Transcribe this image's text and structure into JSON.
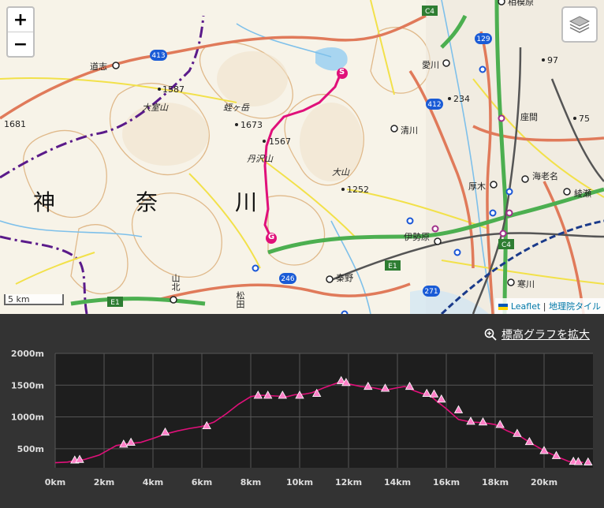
{
  "map": {
    "zoom_in": "+",
    "zoom_out": "−",
    "scale_label": "5 km",
    "attribution_leaflet": "Leaflet",
    "attribution_separator": " | ",
    "attribution_tiles": "地理院タイル",
    "region_chars": [
      "神",
      "奈",
      "川"
    ],
    "place_labels": [
      "道志",
      "大室山",
      "蛭ヶ岳",
      "丹沢山",
      "大山",
      "清川",
      "愛川",
      "座間",
      "厚木",
      "海老名",
      "綾瀬",
      "伊勢原",
      "秦野",
      "寒川",
      "山北",
      "松田",
      "相模原"
    ],
    "elevation_labels": [
      "1587",
      "1681",
      "1673",
      "1567",
      "1252",
      "234",
      "97",
      "75"
    ],
    "route_shields": [
      "413",
      "412",
      "129",
      "246",
      "271"
    ],
    "expressway_shields": [
      "C4",
      "C4",
      "E1",
      "E1"
    ],
    "start_marker": "S",
    "goal_marker": "G",
    "route_color": "#e0107a"
  },
  "elevation_panel": {
    "zoom_link": "標高グラフを拡大"
  },
  "chart_data": {
    "type": "line",
    "xlabel": "",
    "ylabel": "",
    "xlim": [
      0,
      22
    ],
    "ylim": [
      200,
      2000
    ],
    "x_ticks": [
      "0km",
      "2km",
      "4km",
      "6km",
      "8km",
      "10km",
      "12km",
      "14km",
      "16km",
      "18km",
      "20km"
    ],
    "y_ticks": [
      "500m",
      "1000m",
      "1500m",
      "2000m"
    ],
    "series": [
      {
        "x": [
          0,
          0.5,
          0.8,
          1.2,
          1.8,
          2.5,
          3.0,
          3.5,
          4.0,
          4.5,
          5.0,
          5.5,
          6.0,
          6.5,
          7.0,
          7.5,
          8.0,
          8.3,
          8.6,
          9.0,
          9.5,
          9.8,
          10.2,
          10.5,
          11.0,
          11.5,
          11.7,
          12.0,
          12.5,
          13.0,
          13.5,
          14.0,
          14.3,
          14.7,
          15.0,
          15.3,
          15.6,
          16.0,
          16.5,
          17.0,
          17.5,
          18.0,
          18.5,
          19.0,
          19.5,
          20.0,
          20.5,
          21.0,
          21.3,
          21.6
        ],
        "y": [
          280,
          290,
          310,
          330,
          400,
          550,
          580,
          600,
          660,
          730,
          780,
          820,
          850,
          920,
          1050,
          1200,
          1320,
          1340,
          1340,
          1330,
          1320,
          1350,
          1360,
          1380,
          1460,
          1530,
          1570,
          1520,
          1480,
          1460,
          1420,
          1460,
          1480,
          1410,
          1370,
          1350,
          1250,
          1130,
          960,
          920,
          910,
          880,
          780,
          700,
          580,
          470,
          380,
          300,
          290,
          285
        ]
      }
    ],
    "markers": [
      {
        "x": 0.8,
        "y": 310
      },
      {
        "x": 1.0,
        "y": 320
      },
      {
        "x": 2.8,
        "y": 560
      },
      {
        "x": 3.1,
        "y": 590
      },
      {
        "x": 4.5,
        "y": 750
      },
      {
        "x": 6.2,
        "y": 850
      },
      {
        "x": 8.3,
        "y": 1330
      },
      {
        "x": 8.7,
        "y": 1330
      },
      {
        "x": 9.3,
        "y": 1330
      },
      {
        "x": 10.0,
        "y": 1330
      },
      {
        "x": 10.7,
        "y": 1360
      },
      {
        "x": 11.7,
        "y": 1560
      },
      {
        "x": 11.9,
        "y": 1530
      },
      {
        "x": 12.8,
        "y": 1470
      },
      {
        "x": 13.5,
        "y": 1440
      },
      {
        "x": 14.5,
        "y": 1470
      },
      {
        "x": 15.2,
        "y": 1360
      },
      {
        "x": 15.5,
        "y": 1350
      },
      {
        "x": 15.8,
        "y": 1270
      },
      {
        "x": 16.5,
        "y": 1100
      },
      {
        "x": 17.0,
        "y": 920
      },
      {
        "x": 17.5,
        "y": 910
      },
      {
        "x": 18.2,
        "y": 870
      },
      {
        "x": 18.9,
        "y": 730
      },
      {
        "x": 19.4,
        "y": 600
      },
      {
        "x": 20.0,
        "y": 460
      },
      {
        "x": 20.5,
        "y": 380
      },
      {
        "x": 21.2,
        "y": 290
      },
      {
        "x": 21.4,
        "y": 285
      },
      {
        "x": 21.8,
        "y": 280
      }
    ],
    "line_color": "#e0107a",
    "marker_color": "#ff80c8"
  }
}
